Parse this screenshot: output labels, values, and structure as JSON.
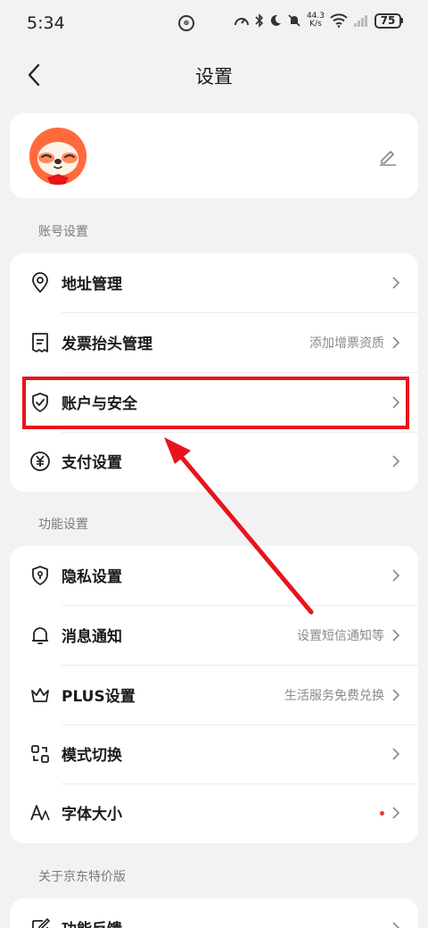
{
  "status_bar": {
    "time": "5:34",
    "net_speed_value": "44.3",
    "net_speed_unit": "K/s",
    "battery": "75"
  },
  "nav": {
    "title": "设置"
  },
  "sections": {
    "account": "账号设置",
    "function": "功能设置",
    "about": "关于京东特价版"
  },
  "account_items": [
    {
      "label": "地址管理",
      "sub": "",
      "icon": "location-pin-icon"
    },
    {
      "label": "发票抬头管理",
      "sub": "添加增票资质",
      "icon": "receipt-icon"
    },
    {
      "label": "账户与安全",
      "sub": "",
      "icon": "shield-icon"
    },
    {
      "label": "支付设置",
      "sub": "",
      "icon": "yen-circle-icon"
    }
  ],
  "function_items": [
    {
      "label": "隐私设置",
      "sub": "",
      "icon": "privacy-shield-icon"
    },
    {
      "label": "消息通知",
      "sub": "设置短信通知等",
      "icon": "bell-icon"
    },
    {
      "label": "PLUS设置",
      "sub": "生活服务免费兑换",
      "icon": "crown-icon"
    },
    {
      "label": "模式切换",
      "sub": "",
      "icon": "switch-mode-icon"
    },
    {
      "label": "字体大小",
      "sub": "",
      "icon": "font-size-icon",
      "has_red_dot": true
    }
  ],
  "about_items": [
    {
      "label": "功能反馈",
      "icon": "feedback-icon"
    }
  ],
  "colors": {
    "highlight": "#e8141c",
    "avatar": "#ff6a3c",
    "background": "#f2f2f4"
  }
}
